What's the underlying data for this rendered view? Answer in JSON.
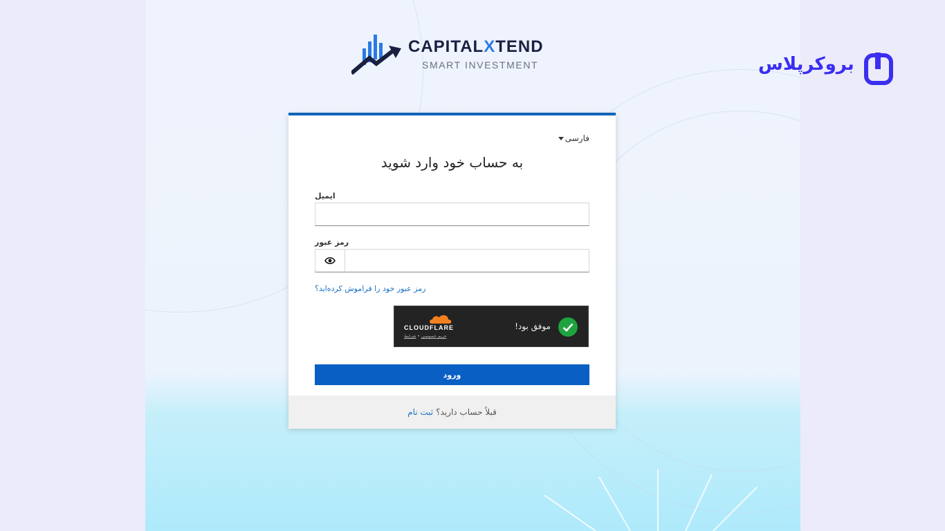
{
  "brand": {
    "name_prefix": "CAPITAL",
    "name_x": "X",
    "name_suffix": "TEND",
    "tagline": "SMART INVESTMENT"
  },
  "watermark": {
    "text": "بروکرپلاس"
  },
  "login": {
    "language": "فارسی",
    "title": "به حساب خود وارد شوید",
    "email_label": "ایمیل",
    "email_value": "",
    "password_label": "رمز عبور",
    "password_value": "",
    "forgot_link": "رمز عبور خود را فراموش کرده‌اید؟",
    "submit_label": "ورود",
    "footer_text": "قبلاً حساب دارید؟",
    "footer_link": "ثبت نام"
  },
  "captcha": {
    "status": "موفق بود!",
    "provider": "CLOUDFLARE",
    "privacy_link": "حریم خصوصی",
    "separator": "•",
    "terms_link": "شرایط"
  },
  "colors": {
    "primary": "#0a5fc4",
    "brand_dark": "#1a2040",
    "brand_accent": "#2b7be4",
    "success": "#1fa33f",
    "cloudflare_orange": "#f48120",
    "watermark": "#3b2ef0"
  },
  "icons": {
    "language_caret": "caret-down-icon",
    "password_toggle": "eye-icon",
    "captcha_status": "checkmark-icon",
    "captcha_logo": "cloudflare-cloud-icon",
    "brand_logo": "chart-arrow-icon"
  }
}
